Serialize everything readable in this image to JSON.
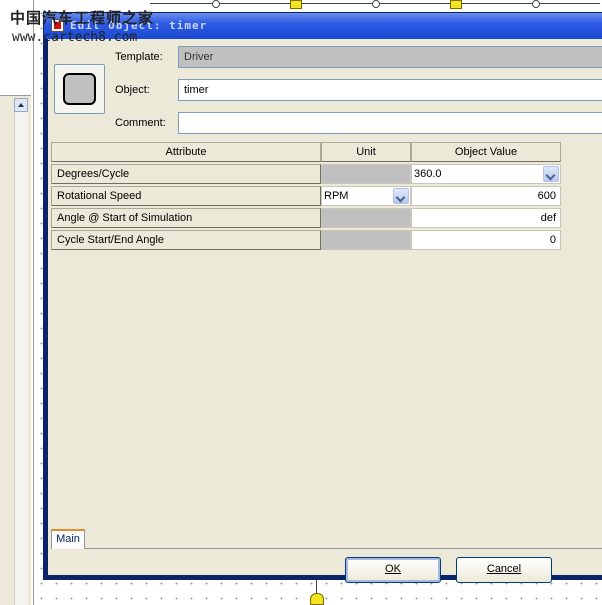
{
  "watermark": {
    "chinese": "中国汽车工程师之家",
    "url": "www.cartech8.com"
  },
  "dialog": {
    "title": "Edit Object: timer",
    "fields": {
      "template_label": "Template:",
      "template_value": "Driver",
      "object_label": "Object:",
      "object_value": "timer",
      "comment_label": "Comment:",
      "comment_value": ""
    },
    "grid": {
      "headers": [
        "Attribute",
        "Unit",
        "Object Value"
      ],
      "rows": [
        {
          "attribute": "Degrees/Cycle",
          "unit": "",
          "value": "360.0"
        },
        {
          "attribute": "Rotational Speed",
          "unit": "RPM",
          "value": "600"
        },
        {
          "attribute": "Angle @ Start of Simulation",
          "unit": "",
          "value": "def"
        },
        {
          "attribute": "Cycle Start/End Angle",
          "unit": "",
          "value": "0"
        }
      ]
    },
    "tabs": [
      {
        "label": "Main"
      }
    ],
    "buttons": {
      "ok_label": "OK",
      "cancel_label": "Cancel"
    }
  },
  "colors": {
    "title_bar": "#2d5be3",
    "dialog_bg": "#ece9d8",
    "readonly_cell": "#c0c0c0",
    "tab_accent": "#e68b2c"
  },
  "icons": {
    "title": "app-icon",
    "object": "rounded-square-driver-icon",
    "combo": "chevron-down-icon"
  }
}
